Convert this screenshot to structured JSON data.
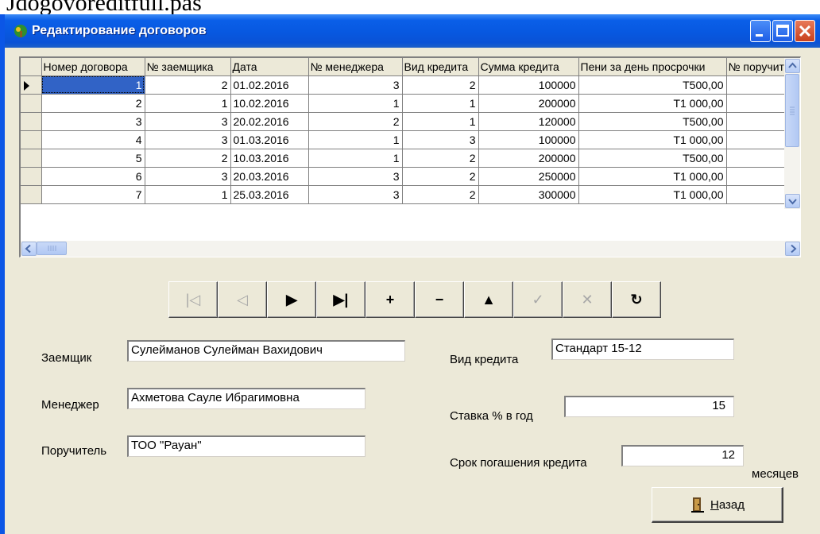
{
  "caption": "Jdogovoreditfull.pas",
  "window": {
    "title": "Редактирование договоров",
    "accent": "#0a58e0"
  },
  "grid": {
    "columns": [
      "Номер договора",
      "№ заемщика",
      "Дата",
      "№ менеджера",
      "Вид кредита",
      "Сумма кредита",
      "Пени за день просрочки",
      "№ поручит"
    ],
    "rows": [
      [
        "1",
        "2",
        "01.02.2016",
        "3",
        "2",
        "100000",
        "T500,00",
        ""
      ],
      [
        "2",
        "1",
        "10.02.2016",
        "1",
        "1",
        "200000",
        "T1 000,00",
        ""
      ],
      [
        "3",
        "3",
        "20.02.2016",
        "2",
        "1",
        "120000",
        "T500,00",
        ""
      ],
      [
        "4",
        "3",
        "01.03.2016",
        "1",
        "3",
        "100000",
        "T1 000,00",
        ""
      ],
      [
        "5",
        "2",
        "10.03.2016",
        "1",
        "2",
        "200000",
        "T500,00",
        ""
      ],
      [
        "6",
        "3",
        "20.03.2016",
        "3",
        "2",
        "250000",
        "T1 000,00",
        ""
      ],
      [
        "7",
        "1",
        "25.03.2016",
        "3",
        "2",
        "300000",
        "T1 000,00",
        ""
      ]
    ]
  },
  "navigator": {
    "buttons": [
      {
        "name": "first",
        "glyph": "|◁",
        "enabled": false
      },
      {
        "name": "prior",
        "glyph": "◁",
        "enabled": false
      },
      {
        "name": "next",
        "glyph": "▶",
        "enabled": true
      },
      {
        "name": "last",
        "glyph": "▶|",
        "enabled": true
      },
      {
        "name": "insert",
        "glyph": "+",
        "enabled": true
      },
      {
        "name": "delete",
        "glyph": "−",
        "enabled": true
      },
      {
        "name": "edit",
        "glyph": "▲",
        "enabled": true
      },
      {
        "name": "post",
        "glyph": "✓",
        "enabled": false
      },
      {
        "name": "cancel",
        "glyph": "✕",
        "enabled": false
      },
      {
        "name": "refresh",
        "glyph": "↻",
        "enabled": true
      }
    ]
  },
  "form": {
    "borrower_label": "Заемщик",
    "borrower_value": "Сулейманов Сулейман Вахидович",
    "manager_label": "Менеджер",
    "manager_value": "Ахметова Сауле Ибрагимовна",
    "guarantor_label": "Поручитель",
    "guarantor_value": "ТОО \"Раyан\"",
    "credit_type_label": "Вид кредита",
    "credit_type_value": "Стандарт 15-12",
    "rate_label": "Ставка % в год",
    "rate_value": "15",
    "term_label": "Срок погашения кредита",
    "term_value": "12",
    "term_unit": "месяцев"
  },
  "back_button": {
    "hotkey": "Н",
    "rest": "азад"
  }
}
